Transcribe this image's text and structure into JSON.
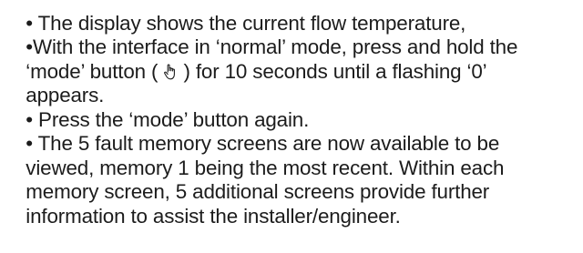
{
  "doc": {
    "lines": [
      "• The display shows the current flow temperature,",
      "•With the interface in ‘normal’ mode, press and hold the",
      "‘mode’ button ( ",
      " ) for 10 seconds until a flashing ‘0’",
      "appears.",
      "• Press the ‘mode’ button again.",
      "• The 5 fault memory screens are now available to be",
      "viewed, memory 1 being the most recent. Within each",
      "memory screen, 5 additional screens provide further",
      "information to assist the installer/engineer."
    ],
    "icon": "hand-pointer-icon"
  }
}
